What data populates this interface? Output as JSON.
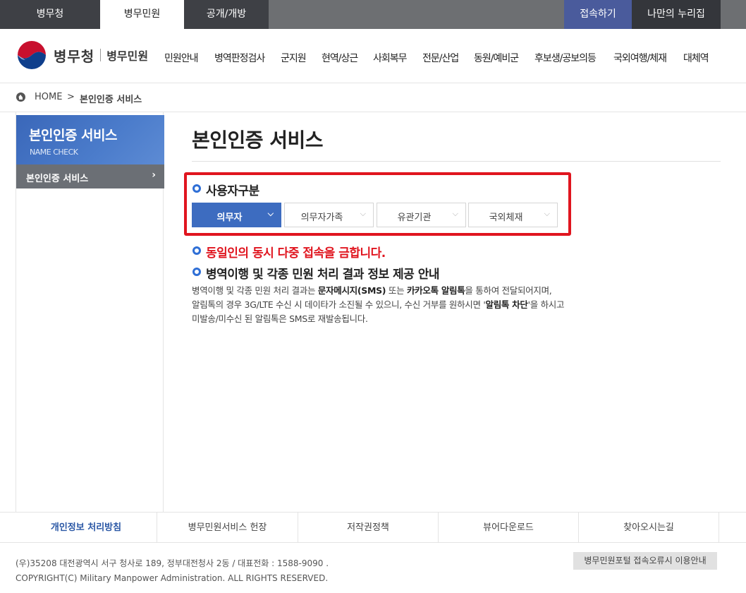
{
  "topbar": {
    "tabs": [
      {
        "label": "병무청",
        "active": false
      },
      {
        "label": "병무민원",
        "active": true
      },
      {
        "label": "공개/개방",
        "active": false
      }
    ],
    "connect_label": "접속하기",
    "mypage_label": "나만의 누리집",
    "colors": {
      "bar": "#6d6f72",
      "tab": "#3e4045",
      "connect": "#4a5b9c",
      "mypage": "#34363b"
    }
  },
  "header": {
    "logo_main": "병무청",
    "logo_sub": "병무민원",
    "nav": [
      "민원안내",
      "병역판정검사",
      "군지원",
      "현역/상근",
      "사회복무",
      "전문/산업",
      "동원/예비군",
      "후보생/공보의등",
      "국외여행/체재",
      "대체역"
    ]
  },
  "breadcrumb": {
    "home": "HOME",
    "separator": ">",
    "current": "본인인증 서비스"
  },
  "sidebar": {
    "title": "본인인증 서비스",
    "subtitle": "NAME CHECK",
    "items": [
      {
        "label": "본인인증 서비스",
        "chevron": "›"
      }
    ]
  },
  "main": {
    "title": "본인인증 서비스",
    "user_type_heading": "사용자구분",
    "user_types": [
      {
        "label": "의무자",
        "selected": true
      },
      {
        "label": "의무자가족",
        "selected": false
      },
      {
        "label": "유관기관",
        "selected": false
      },
      {
        "label": "국외체재",
        "selected": false
      }
    ],
    "warning": "동일인의 동시 다중 접속을 금합니다.",
    "info_heading": "병역이행 및 각종 민원 처리 결과 정보 제공 안내",
    "info_text": {
      "p1": "병역이행 및 각종 민원 처리 결과는 ",
      "b1": "문자메시지(SMS)",
      "p2": " 또는 ",
      "b2": "카카오톡 알림톡",
      "p3": "을 통하여 전달되어지며,",
      "p4": "알림톡의 경우 3G/LTE 수신 시 데이타가 소진될 수 있으니, 수신 거부를 원하시면 '",
      "b3": "알림톡 차단",
      "p5": "'을 하시고",
      "p6": "미발송/미수신 된 알림톡은 SMS로 재발송됩니다."
    },
    "colors": {
      "accent": "#3d6cc0",
      "warning": "#e0151f",
      "highlight_box": "#e0151f"
    }
  },
  "footer": {
    "links": [
      "개인정보 처리방침",
      "병무민원서비스 헌장",
      "저작권정책",
      "뷰어다운로드",
      "찾아오시는길"
    ],
    "address": "(우)35208 대전광역시 서구 청사로 189, 정부대전청사 2동 / 대표전화 : 1588-9090 .",
    "copyright": "COPYRIGHT(C) Military Manpower Administration. ALL RIGHTS RESERVED.",
    "error_guide": "병무민원포털 접속오류시 이용안내"
  }
}
